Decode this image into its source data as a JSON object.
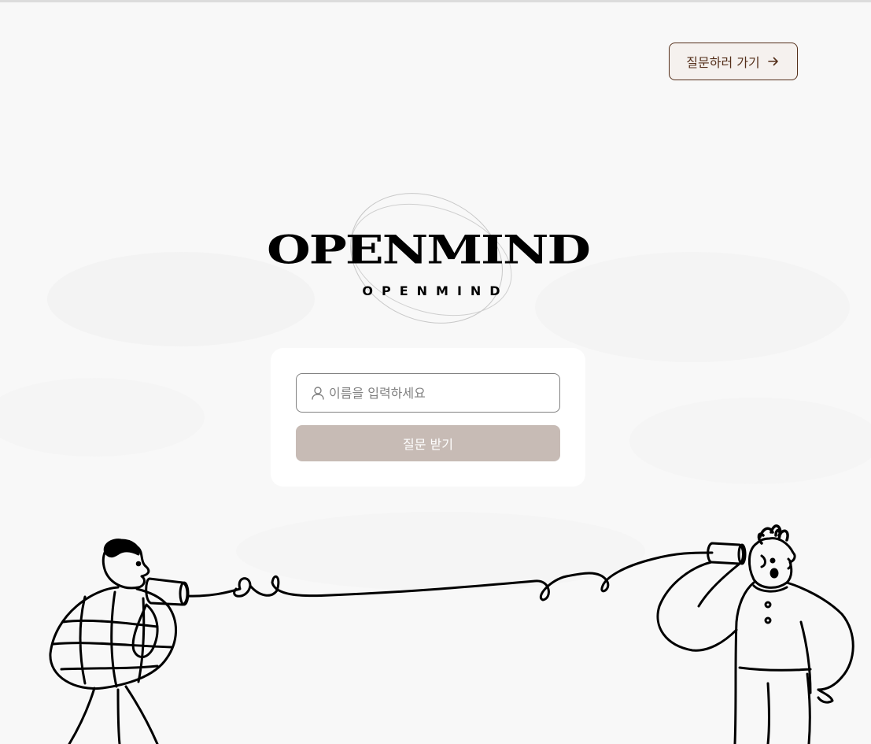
{
  "header": {
    "nav_button_label": "질문하러 가기",
    "nav_button_icon": "arrow-right-icon"
  },
  "logo": {
    "main_text": "OPENMIND",
    "sub_text": "OPENMIND"
  },
  "form": {
    "name_input": {
      "value": "",
      "placeholder": "이름을 입력하세요",
      "icon": "person-icon"
    },
    "submit_label": "질문 받기"
  },
  "colors": {
    "background": "#f8f8f8",
    "brand_brown": "#542f1a",
    "nav_button_bg": "#f5f1ee",
    "submit_disabled": "#c7bbb5",
    "card_bg": "#ffffff"
  }
}
